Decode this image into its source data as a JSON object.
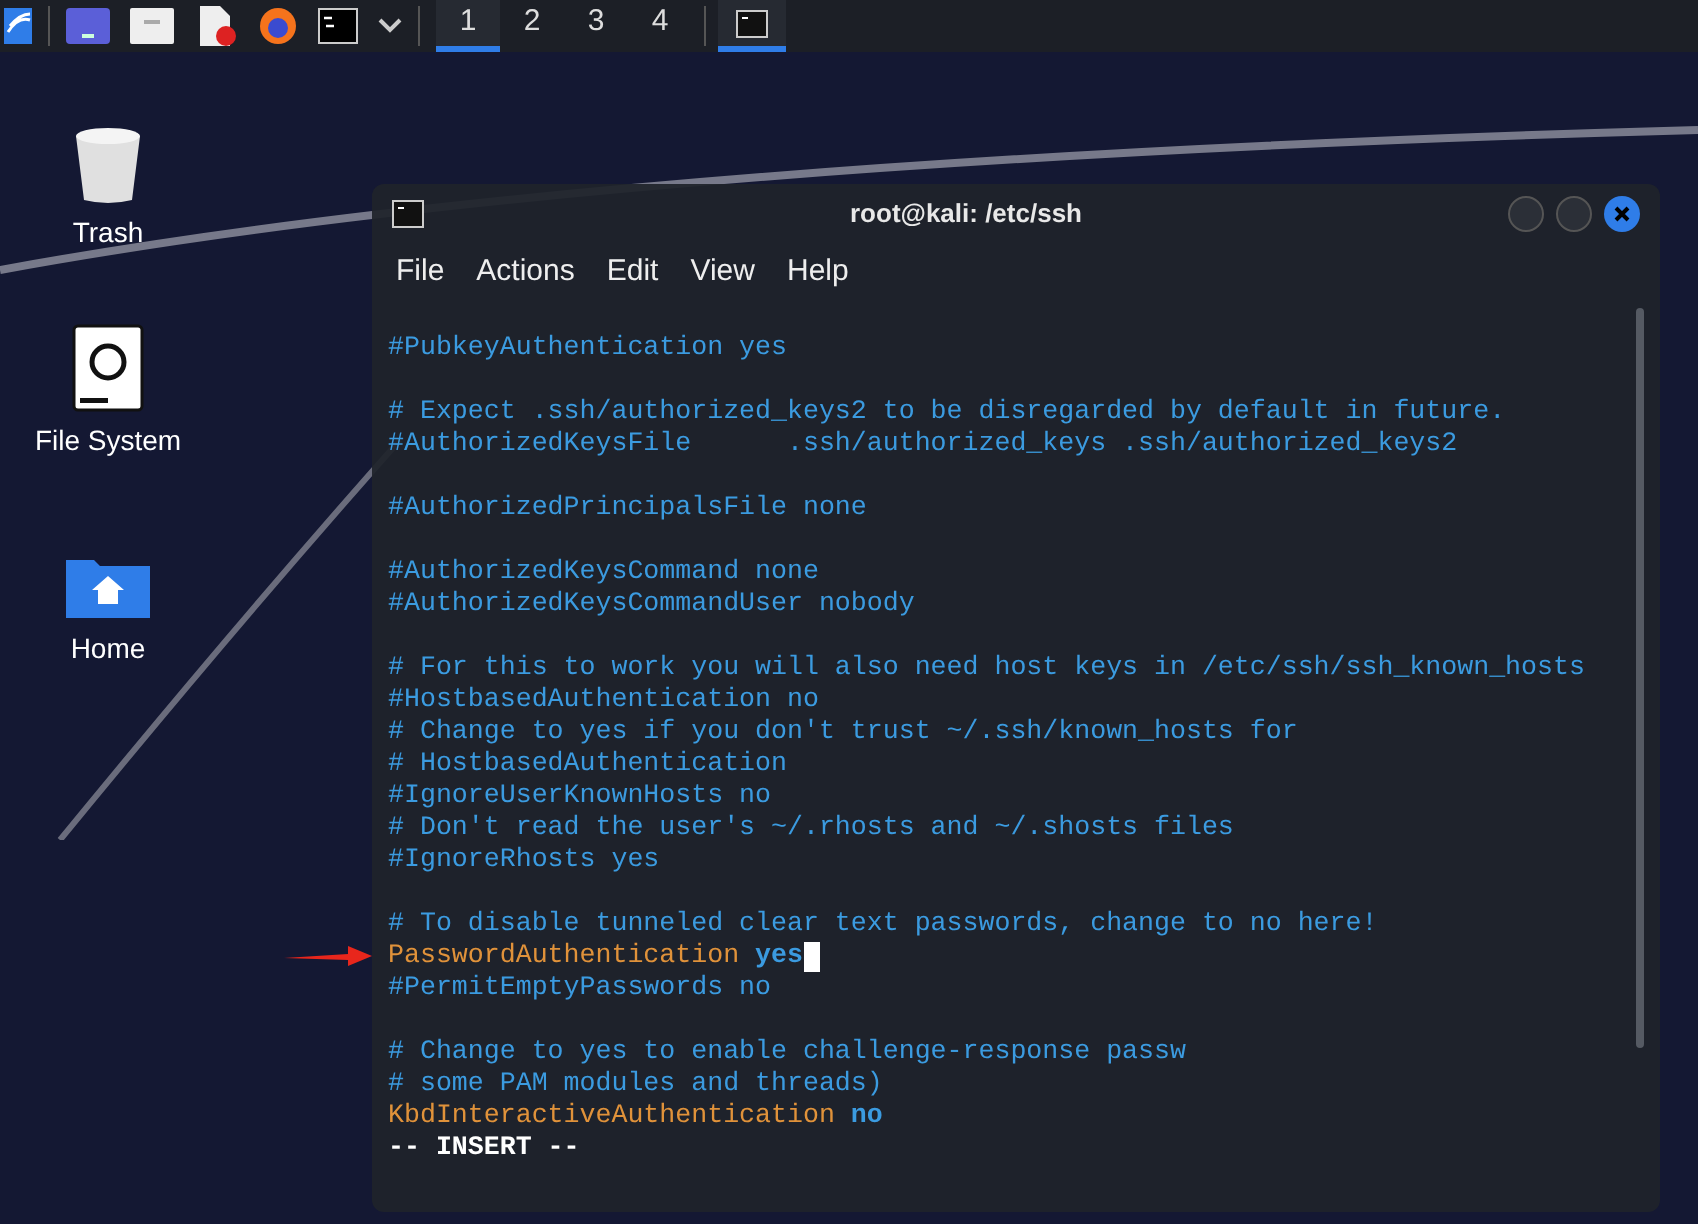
{
  "taskbar": {
    "workspaces": [
      {
        "label": "1",
        "selected": true
      },
      {
        "label": "2",
        "selected": false
      },
      {
        "label": "3",
        "selected": false
      },
      {
        "label": "4",
        "selected": false
      }
    ],
    "tasks": [
      {
        "selected": true
      }
    ]
  },
  "desktop_icons": [
    {
      "label": "Trash",
      "kind": "trash"
    },
    {
      "label": "File System",
      "kind": "drive"
    },
    {
      "label": "Home",
      "kind": "home"
    }
  ],
  "terminal": {
    "title": "root@kali: /etc/ssh",
    "menu": [
      "File",
      "Actions",
      "Edit",
      "View",
      "Help"
    ],
    "blocks": [
      [
        {
          "kind": "comment",
          "text": "#PubkeyAuthentication yes"
        }
      ],
      [
        {
          "kind": "comment",
          "text": "# Expect .ssh/authorized_keys2 to be disregarded by default in future."
        },
        {
          "kind": "comment",
          "text": "#AuthorizedKeysFile      .ssh/authorized_keys .ssh/authorized_keys2"
        }
      ],
      [
        {
          "kind": "comment",
          "text": "#AuthorizedPrincipalsFile none"
        }
      ],
      [
        {
          "kind": "comment",
          "text": "#AuthorizedKeysCommand none"
        },
        {
          "kind": "comment",
          "text": "#AuthorizedKeysCommandUser nobody"
        }
      ],
      [
        {
          "kind": "comment",
          "text": "# For this to work you will also need host keys in /etc/ssh/ssh_known_hosts"
        },
        {
          "kind": "comment",
          "text": "#HostbasedAuthentication no"
        },
        {
          "kind": "comment",
          "text": "# Change to yes if you don't trust ~/.ssh/known_hosts for"
        },
        {
          "kind": "comment",
          "text": "# HostbasedAuthentication"
        },
        {
          "kind": "comment",
          "text": "#IgnoreUserKnownHosts no"
        },
        {
          "kind": "comment",
          "text": "# Don't read the user's ~/.rhosts and ~/.shosts files"
        },
        {
          "kind": "comment",
          "text": "#IgnoreRhosts yes"
        }
      ],
      [
        {
          "kind": "comment",
          "text": "# To disable tunneled clear text passwords, change to no here!"
        },
        {
          "kind": "setting",
          "key": "PasswordAuthentication",
          "value": "yes",
          "cursor": true,
          "highlighted": true
        },
        {
          "kind": "comment",
          "text": "#PermitEmptyPasswords no"
        }
      ],
      [
        {
          "kind": "comment",
          "text": "# Change to yes to enable challenge-response passw"
        },
        {
          "kind": "comment",
          "text": "# some PAM modules and threads)"
        },
        {
          "kind": "setting",
          "key": "KbdInteractiveAuthentication",
          "value": "no",
          "cursor": false,
          "highlighted": false
        },
        {
          "kind": "mode",
          "text": "-- INSERT --"
        }
      ]
    ]
  }
}
